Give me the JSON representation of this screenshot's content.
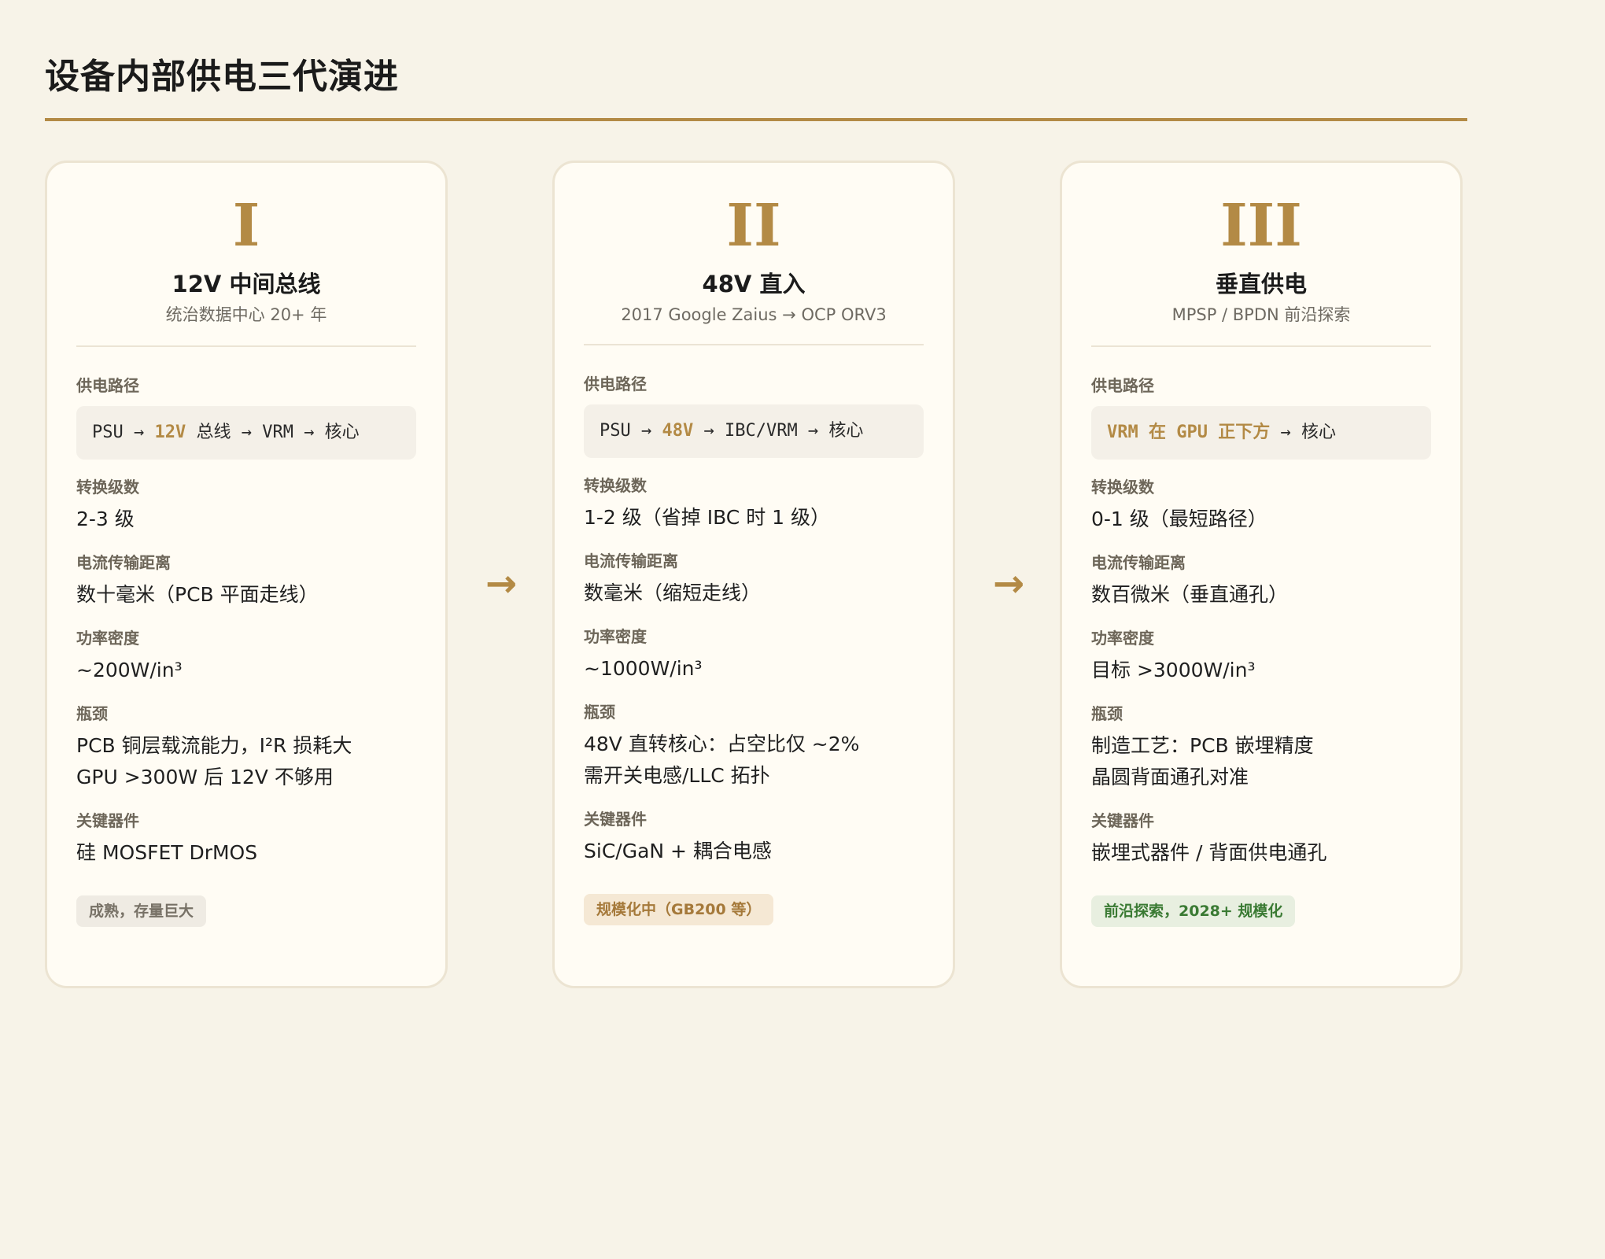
{
  "page": {
    "title": "设备内部供电三代演进"
  },
  "arrows": {
    "symbol": "→"
  },
  "cards": [
    {
      "numeral": "I",
      "title": "12V 中间总线",
      "subtitle": "统治数据中心 20+ 年",
      "path_label": "供电路径",
      "path_pre": "PSU → ",
      "path_highlight": "12V",
      "path_post": " 总线 → VRM → 核心",
      "stages_label": "转换级数",
      "stages_value": "2-3 级",
      "distance_label": "电流传输距离",
      "distance_value": "数十毫米（PCB 平面走线）",
      "density_label": "功率密度",
      "density_value": "~200W/in³",
      "bottleneck_label": "瓶颈",
      "bottleneck_line1": "PCB 铜层载流能力，I²R 损耗大",
      "bottleneck_line2": "GPU >300W 后 12V 不够用",
      "components_label": "关键器件",
      "components_value": "硅 MOSFET DrMOS",
      "badge": "成熟，存量巨大"
    },
    {
      "numeral": "II",
      "title": "48V 直入",
      "subtitle": "2017 Google Zaius → OCP ORV3",
      "path_label": "供电路径",
      "path_pre": "PSU → ",
      "path_highlight": "48V",
      "path_post": " → IBC/VRM → 核心",
      "stages_label": "转换级数",
      "stages_value": "1-2 级（省掉 IBC 时 1 级）",
      "distance_label": "电流传输距离",
      "distance_value": "数毫米（缩短走线）",
      "density_label": "功率密度",
      "density_value": "~1000W/in³",
      "bottleneck_label": "瓶颈",
      "bottleneck_line1": "48V 直转核心：占空比仅 ~2%",
      "bottleneck_line2": "需开关电感/LLC 拓扑",
      "components_label": "关键器件",
      "components_value": "SiC/GaN + 耦合电感",
      "badge": "规模化中（GB200 等）"
    },
    {
      "numeral": "III",
      "title": "垂直供电",
      "subtitle": "MPSP / BPDN 前沿探索",
      "path_label": "供电路径",
      "path_pre": "",
      "path_highlight": "VRM 在 GPU 正下方",
      "path_post": " → 核心",
      "stages_label": "转换级数",
      "stages_value": "0-1 级（最短路径）",
      "distance_label": "电流传输距离",
      "distance_value": "数百微米（垂直通孔）",
      "density_label": "功率密度",
      "density_value": "目标 >3000W/in³",
      "bottleneck_label": "瓶颈",
      "bottleneck_line1": "制造工艺：PCB 嵌埋精度",
      "bottleneck_line2": "晶圆背面通孔对准",
      "components_label": "关键器件",
      "components_value": "嵌埋式器件 / 背面供电通孔",
      "badge": "前沿探索，2028+ 规模化"
    }
  ],
  "colors": {
    "background": "#f7f3e8",
    "accent": "#b38a45",
    "card": "#fffcf4",
    "badge_green": "#3a7a33"
  }
}
